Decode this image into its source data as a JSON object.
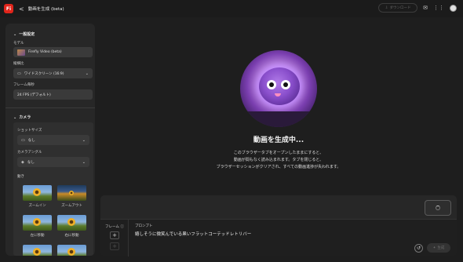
{
  "topbar": {
    "app_logo": "Fi",
    "back_glyph": "<",
    "title": "動画を生成 (beta)",
    "download_label": "ダウンロード"
  },
  "sidebar": {
    "general_heading": "一般設定",
    "model_label": "モデル",
    "model_value": "Firefly Video (beta)",
    "aspect_label": "縦横比",
    "aspect_value": "ワイドスクリーン (16:9)",
    "fps_label": "フレーム毎秒",
    "fps_value": "24 FPS (デフォルト)",
    "camera_heading": "カメラ",
    "shot_label": "ショットサイズ",
    "shot_value": "なし",
    "angle_label": "カメラアングル",
    "angle_value": "なし",
    "motion_label": "動き",
    "motions": [
      "ズームイン",
      "ズームアウト",
      "左に移動",
      "右に移動"
    ]
  },
  "main": {
    "heading": "動画を生成中...",
    "lines": [
      "このブラウザータブをオープンしたままにすると、",
      "動画が間もなく読み込まれます。タブを閉じると、",
      "ブラウザーセッションがクリアされ、すべての動画進捗が失われます。"
    ]
  },
  "prompt_panel": {
    "frame_label": "フレーム",
    "prompt_label": "プロンプト",
    "prompt_value": "嬉しそうに微笑んでいる黒いフラットコーテッドレトリバー",
    "generate_label": "生成"
  }
}
